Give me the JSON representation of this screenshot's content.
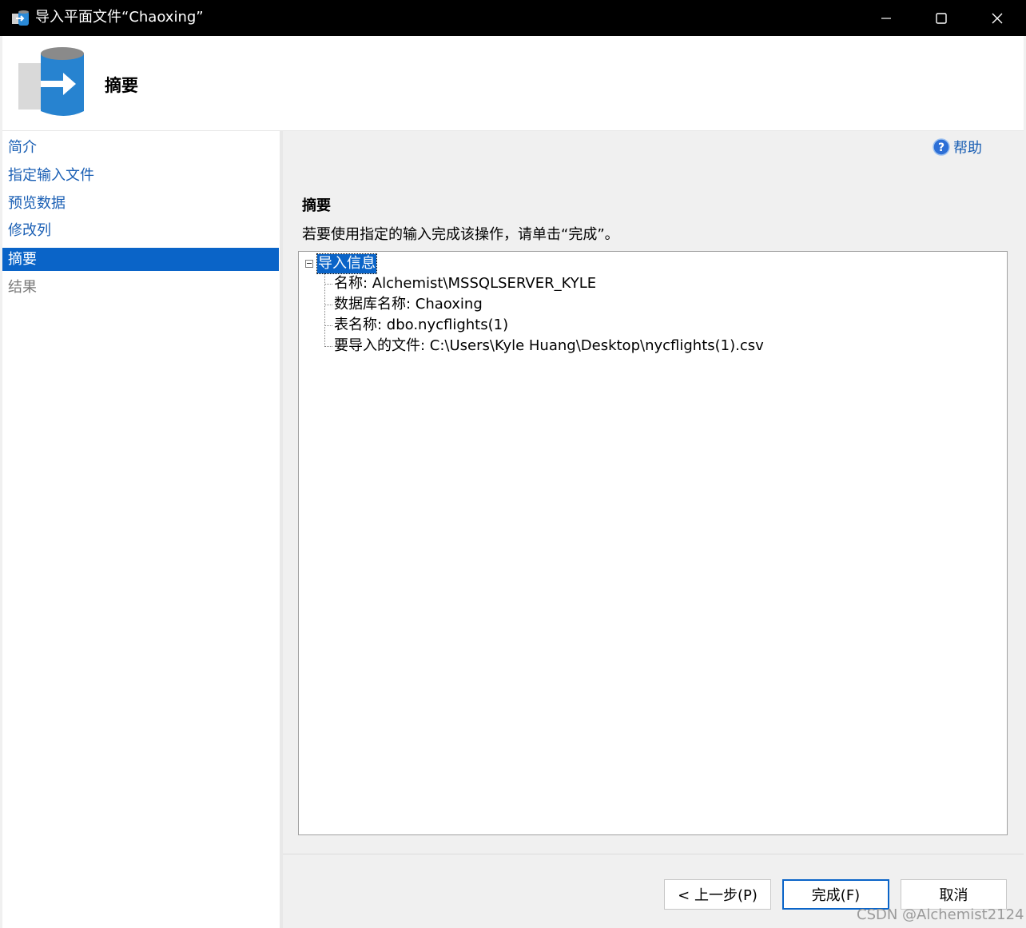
{
  "window": {
    "title": "导入平面文件“Chaoxing”",
    "controls": [
      "minimize-icon",
      "maximize-icon",
      "close-icon"
    ]
  },
  "banner": {
    "title": "摘要",
    "icon": "database-import-icon"
  },
  "nav": {
    "items": [
      {
        "label": "简介"
      },
      {
        "label": "指定输入文件"
      },
      {
        "label": "预览数据"
      },
      {
        "label": "修改列"
      },
      {
        "label": "摘要"
      },
      {
        "label": "结果"
      }
    ],
    "active_index": 4
  },
  "help": {
    "label": "帮助",
    "icon": "help-icon"
  },
  "main": {
    "section_title": "摘要",
    "description": "若要使用指定的输入完成该操作，请单击“完成”。",
    "tree": {
      "root": "导入信息",
      "children": [
        "名称: Alchemist\\MSSQLSERVER_KYLE",
        "数据库名称: Chaoxing",
        "表名称: dbo.nycflights(1)",
        "要导入的文件: C:\\Users\\Kyle Huang\\Desktop\\nycflights(1).csv"
      ]
    }
  },
  "buttons": {
    "back": "< 上一步(P)",
    "finish": "完成(F)",
    "cancel": "取消"
  },
  "watermark": "CSDN @Alchemist2124",
  "colors": {
    "accent": "#0a64c8",
    "link": "#1a5fb4",
    "titlebar": "#000000"
  }
}
